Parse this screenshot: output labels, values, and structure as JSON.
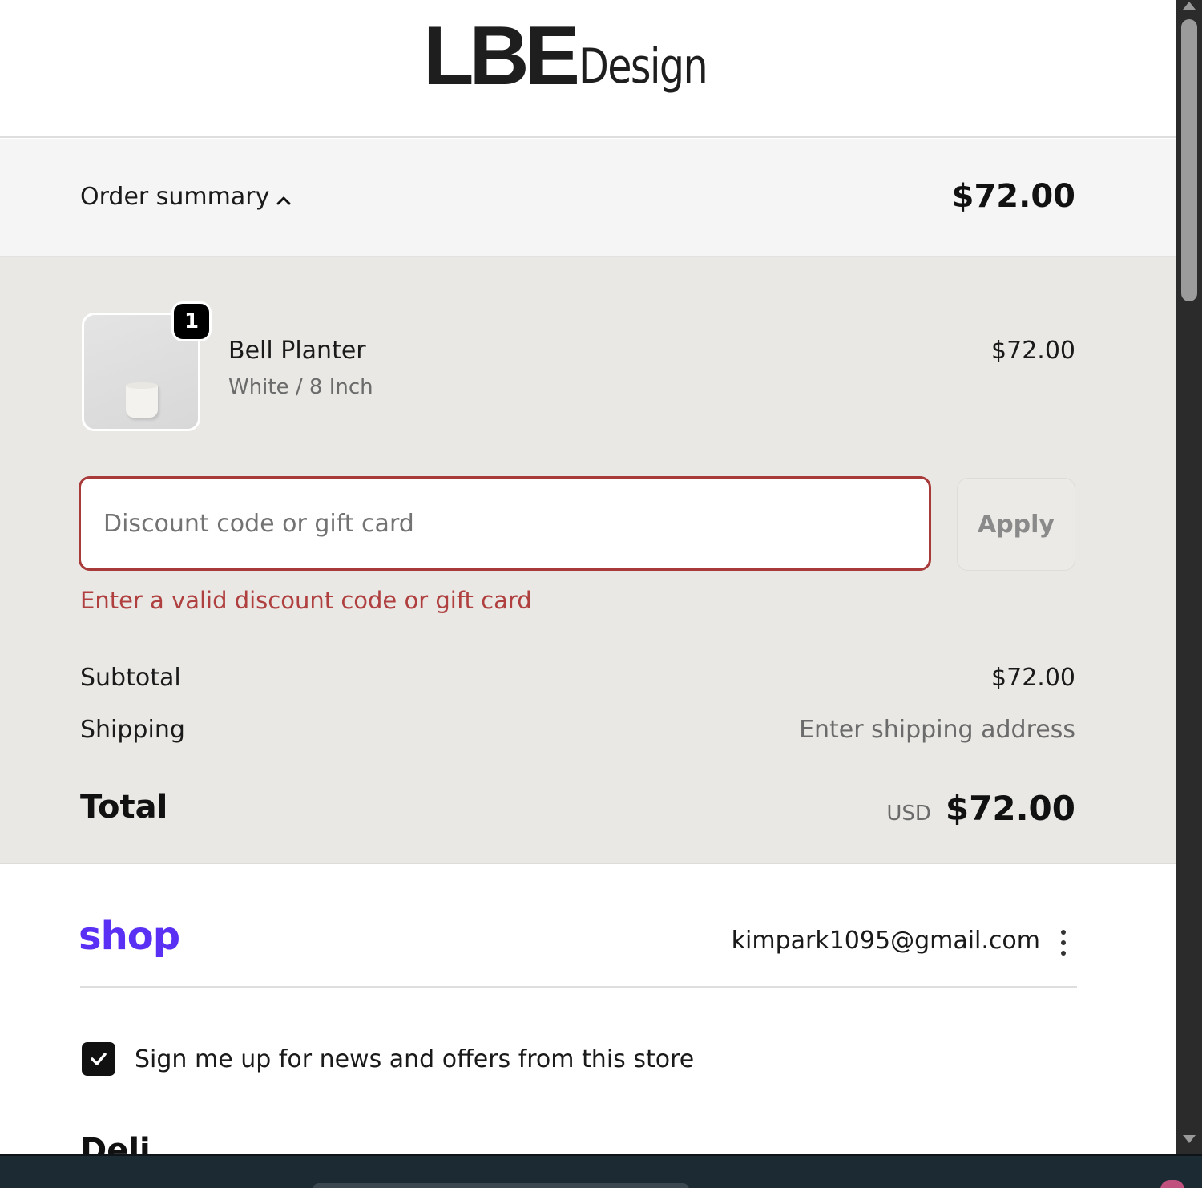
{
  "header": {
    "logo_main": "LBE",
    "logo_sub": "Design"
  },
  "summary_toggle": {
    "label": "Order summary",
    "total": "$72.00",
    "expanded": true
  },
  "line_item": {
    "quantity": "1",
    "name": "Bell Planter",
    "variant": "White / 8 Inch",
    "price": "$72.00"
  },
  "discount": {
    "placeholder": "Discount code or gift card",
    "value": "",
    "apply_label": "Apply",
    "error": "Enter a valid discount code or gift card"
  },
  "totals": {
    "subtotal_label": "Subtotal",
    "subtotal_value": "$72.00",
    "shipping_label": "Shipping",
    "shipping_value": "Enter shipping address",
    "total_label": "Total",
    "currency": "USD",
    "total_value": "$72.00"
  },
  "shop_account": {
    "logo": "shop",
    "email": "kimpark1095@gmail.com",
    "brand_color": "#5a31f4"
  },
  "newsletter": {
    "label": "Sign me up for news and offers from this store",
    "checked": true
  },
  "next_section": {
    "heading_partial": "Deli"
  },
  "colors": {
    "error": "#b04040",
    "panel_bg": "#e9e8e4",
    "toggle_bg": "#f5f5f5"
  }
}
